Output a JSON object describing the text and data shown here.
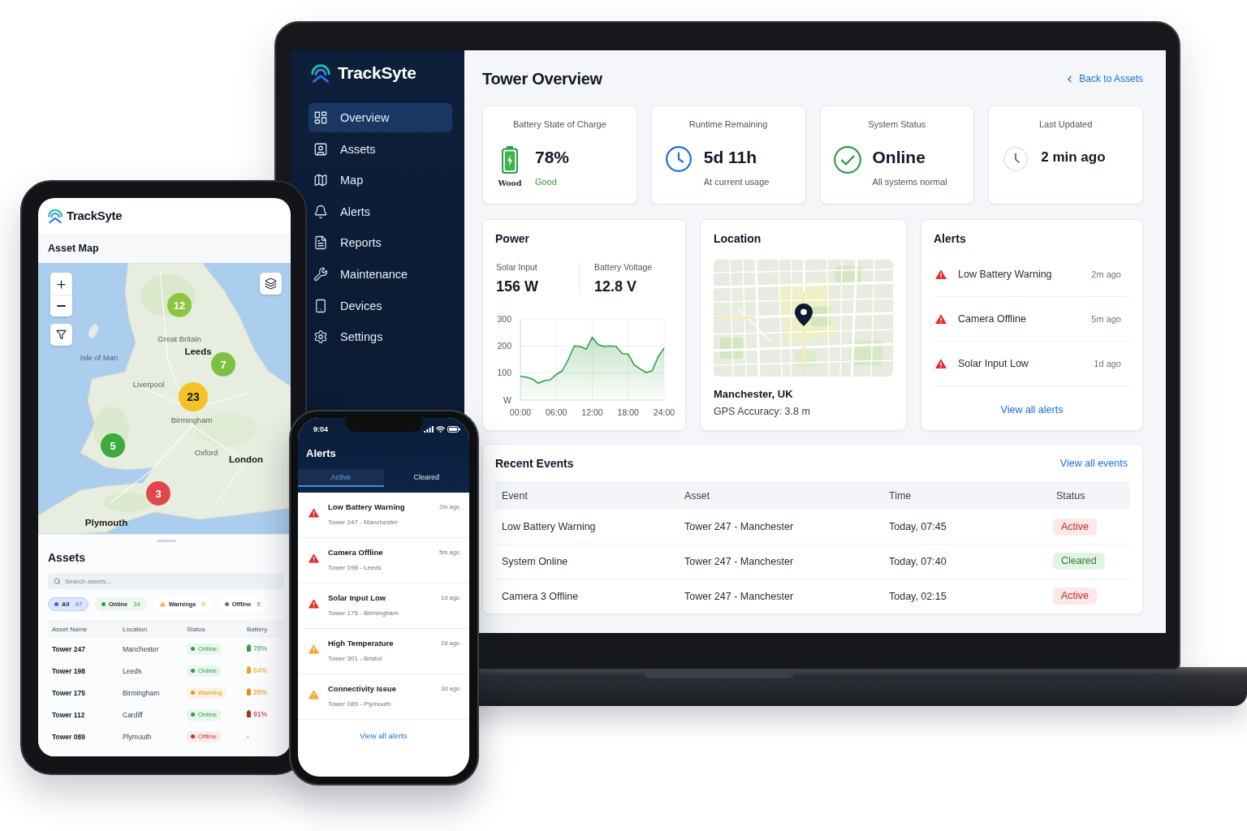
{
  "laptop": {
    "sidebar": {
      "brand": "TrackSyte",
      "items": [
        {
          "label": "Overview",
          "selected": true
        },
        {
          "label": "Assets",
          "selected": false
        },
        {
          "label": "Map",
          "selected": false
        },
        {
          "label": "Alerts",
          "selected": false
        },
        {
          "label": "Reports",
          "selected": false
        },
        {
          "label": "Maintenance",
          "selected": false
        },
        {
          "label": "Devices",
          "selected": false
        },
        {
          "label": "Settings",
          "selected": false
        }
      ]
    },
    "header": {
      "title": "Tower Overview",
      "back_link": "Back to Assets"
    },
    "stat_cards": [
      {
        "kind": "battery",
        "title": "Battery State of Charge",
        "value": "78%",
        "note": "Good",
        "icon_caption": "Wood"
      },
      {
        "kind": "runtime",
        "title": "Runtime Remaining",
        "value": "5d 11h",
        "note": "At current usage"
      },
      {
        "kind": "status",
        "title": "System Status",
        "value": "Online",
        "note": "All systems normal"
      },
      {
        "kind": "updated",
        "title": "Last Updated",
        "value": "2 min ago"
      }
    ],
    "power": {
      "title": "Power",
      "metrics": [
        {
          "label": "Solar Input",
          "value": "156 W"
        },
        {
          "label": "Battery Voltage",
          "value": "12.8 V"
        }
      ],
      "chart_data": {
        "type": "area",
        "ylabel": "W",
        "x": [
          0,
          1,
          2,
          3,
          4,
          5,
          6,
          7,
          8,
          9,
          10,
          11,
          12,
          13,
          14,
          15,
          16,
          17,
          18,
          19,
          20,
          21,
          22,
          23,
          24
        ],
        "series": [
          {
            "color": "#2ea043",
            "values": [
              88,
              85,
              78,
              62,
              72,
              75,
              95,
              108,
              150,
              200,
              198,
              188,
              232,
              205,
              198,
              200,
              198,
              172,
              170,
              130,
              115,
              102,
              108,
              160,
              192
            ]
          }
        ],
        "xlim": [
          0,
          24
        ],
        "ylim": [
          0,
          300
        ],
        "xticks": [
          {
            "value": 0,
            "label": "00:00"
          },
          {
            "value": 6,
            "label": "06:00"
          },
          {
            "value": 12,
            "label": "12:00"
          },
          {
            "value": 18,
            "label": "18:00"
          },
          {
            "value": 24,
            "label": "24:00"
          }
        ],
        "yticks": [
          100,
          200,
          300
        ],
        "grid": true
      }
    },
    "location": {
      "title": "Location",
      "place": "Manchester, UK",
      "accuracy": "GPS Accuracy: 3.8 m"
    },
    "alerts": {
      "title": "Alerts",
      "items": [
        {
          "title": "Low Battery Warning",
          "time": "2m ago"
        },
        {
          "title": "Camera Offline",
          "time": "5m ago"
        },
        {
          "title": "Solar Input Low",
          "time": "1d ago"
        }
      ],
      "link": "View all alerts"
    },
    "recent_events": {
      "title": "Recent Events",
      "link": "View all events",
      "columns": [
        "Event",
        "Asset",
        "Time",
        "Status"
      ],
      "rows": [
        {
          "event": "Low Battery Warning",
          "asset": "Tower 247 - Manchester",
          "time": "Today, 07:45",
          "status": {
            "label": "Active",
            "kind": "active"
          }
        },
        {
          "event": "System Online",
          "asset": "Tower 247 - Manchester",
          "time": "Today, 07:40",
          "status": {
            "label": "Cleared",
            "kind": "cleared"
          }
        },
        {
          "event": "Camera 3 Offline",
          "asset": "Tower 247 - Manchester",
          "time": "Today, 02:15",
          "status": {
            "label": "Active",
            "kind": "active"
          }
        }
      ]
    }
  },
  "tablet": {
    "brand": "TrackSyte",
    "map": {
      "title": "Asset Map",
      "labels": [
        {
          "name": "Great Britain",
          "major": false
        },
        {
          "name": "Isle of Man",
          "major": false
        },
        {
          "name": "Leeds",
          "major": true
        },
        {
          "name": "Liverpool",
          "major": false
        },
        {
          "name": "Birmingham",
          "major": false
        },
        {
          "name": "Oxford",
          "major": false
        },
        {
          "name": "London",
          "major": true
        },
        {
          "name": "Plymouth",
          "major": true
        }
      ],
      "clusters": [
        {
          "count": "12",
          "color": "#8cc63f"
        },
        {
          "count": "7",
          "color": "#7cc142"
        },
        {
          "count": "23",
          "color": "#f6c324"
        },
        {
          "count": "5",
          "color": "#3caa3c"
        },
        {
          "count": "3",
          "color": "#e0474c"
        }
      ]
    },
    "assets": {
      "title": "Assets",
      "search": {
        "placeholder": "Search assets..."
      },
      "filters": [
        {
          "kind": "all",
          "label": "All",
          "count": "47",
          "selected": true
        },
        {
          "kind": "online",
          "label": "Online",
          "count": "34",
          "selected": false
        },
        {
          "kind": "warning",
          "label": "Warnings",
          "count": "8",
          "selected": false
        },
        {
          "kind": "offline",
          "label": "Offline",
          "count": "5",
          "selected": false
        }
      ],
      "columns": [
        "Asset Name",
        "Location",
        "Status",
        "Battery"
      ],
      "rows": [
        {
          "name": "Tower 247",
          "location": "Manchester",
          "status": {
            "label": "Online",
            "kind": "online"
          },
          "battery": {
            "value": "78%",
            "color": "#2f9e44"
          }
        },
        {
          "name": "Tower 198",
          "location": "Leeds",
          "status": {
            "label": "Online",
            "kind": "online"
          },
          "battery": {
            "value": "64%",
            "color": "#e8a317"
          }
        },
        {
          "name": "Tower 175",
          "location": "Birmingham",
          "status": {
            "label": "Warning",
            "kind": "warning"
          },
          "battery": {
            "value": "28%",
            "color": "#ee8a12"
          }
        },
        {
          "name": "Tower 112",
          "location": "Cardiff",
          "status": {
            "label": "Online",
            "kind": "online"
          },
          "battery": {
            "value": "91%",
            "color": "#b42318"
          }
        },
        {
          "name": "Tower 089",
          "location": "Plymouth",
          "status": {
            "label": "Offline",
            "kind": "offline"
          },
          "battery": {
            "value": "-"
          }
        }
      ]
    }
  },
  "phone": {
    "time": "9:04",
    "title": "Alerts",
    "tabs": [
      {
        "label": "Active",
        "selected": true
      },
      {
        "label": "Cleared",
        "selected": false
      }
    ],
    "alerts": [
      {
        "title": "Low Battery Warning",
        "asset": "Tower 247 - Manchester",
        "time": "2m ago",
        "color": "#e02d2d"
      },
      {
        "title": "Camera Offline",
        "asset": "Tower 198 - Leeds",
        "time": "5m ago",
        "color": "#e02d2d"
      },
      {
        "title": "Solar Input Low",
        "asset": "Tower 175 - Birmingham",
        "time": "1d ago",
        "color": "#e02d2d"
      },
      {
        "title": "High Temperature",
        "asset": "Tower 301 - Bristol",
        "time": "2d ago",
        "color": "#f5a524"
      },
      {
        "title": "Connectivity Issue",
        "asset": "Tower 089 - Plymouth",
        "time": "3d ago",
        "color": "#f5a524"
      }
    ],
    "link": "View all alerts"
  }
}
